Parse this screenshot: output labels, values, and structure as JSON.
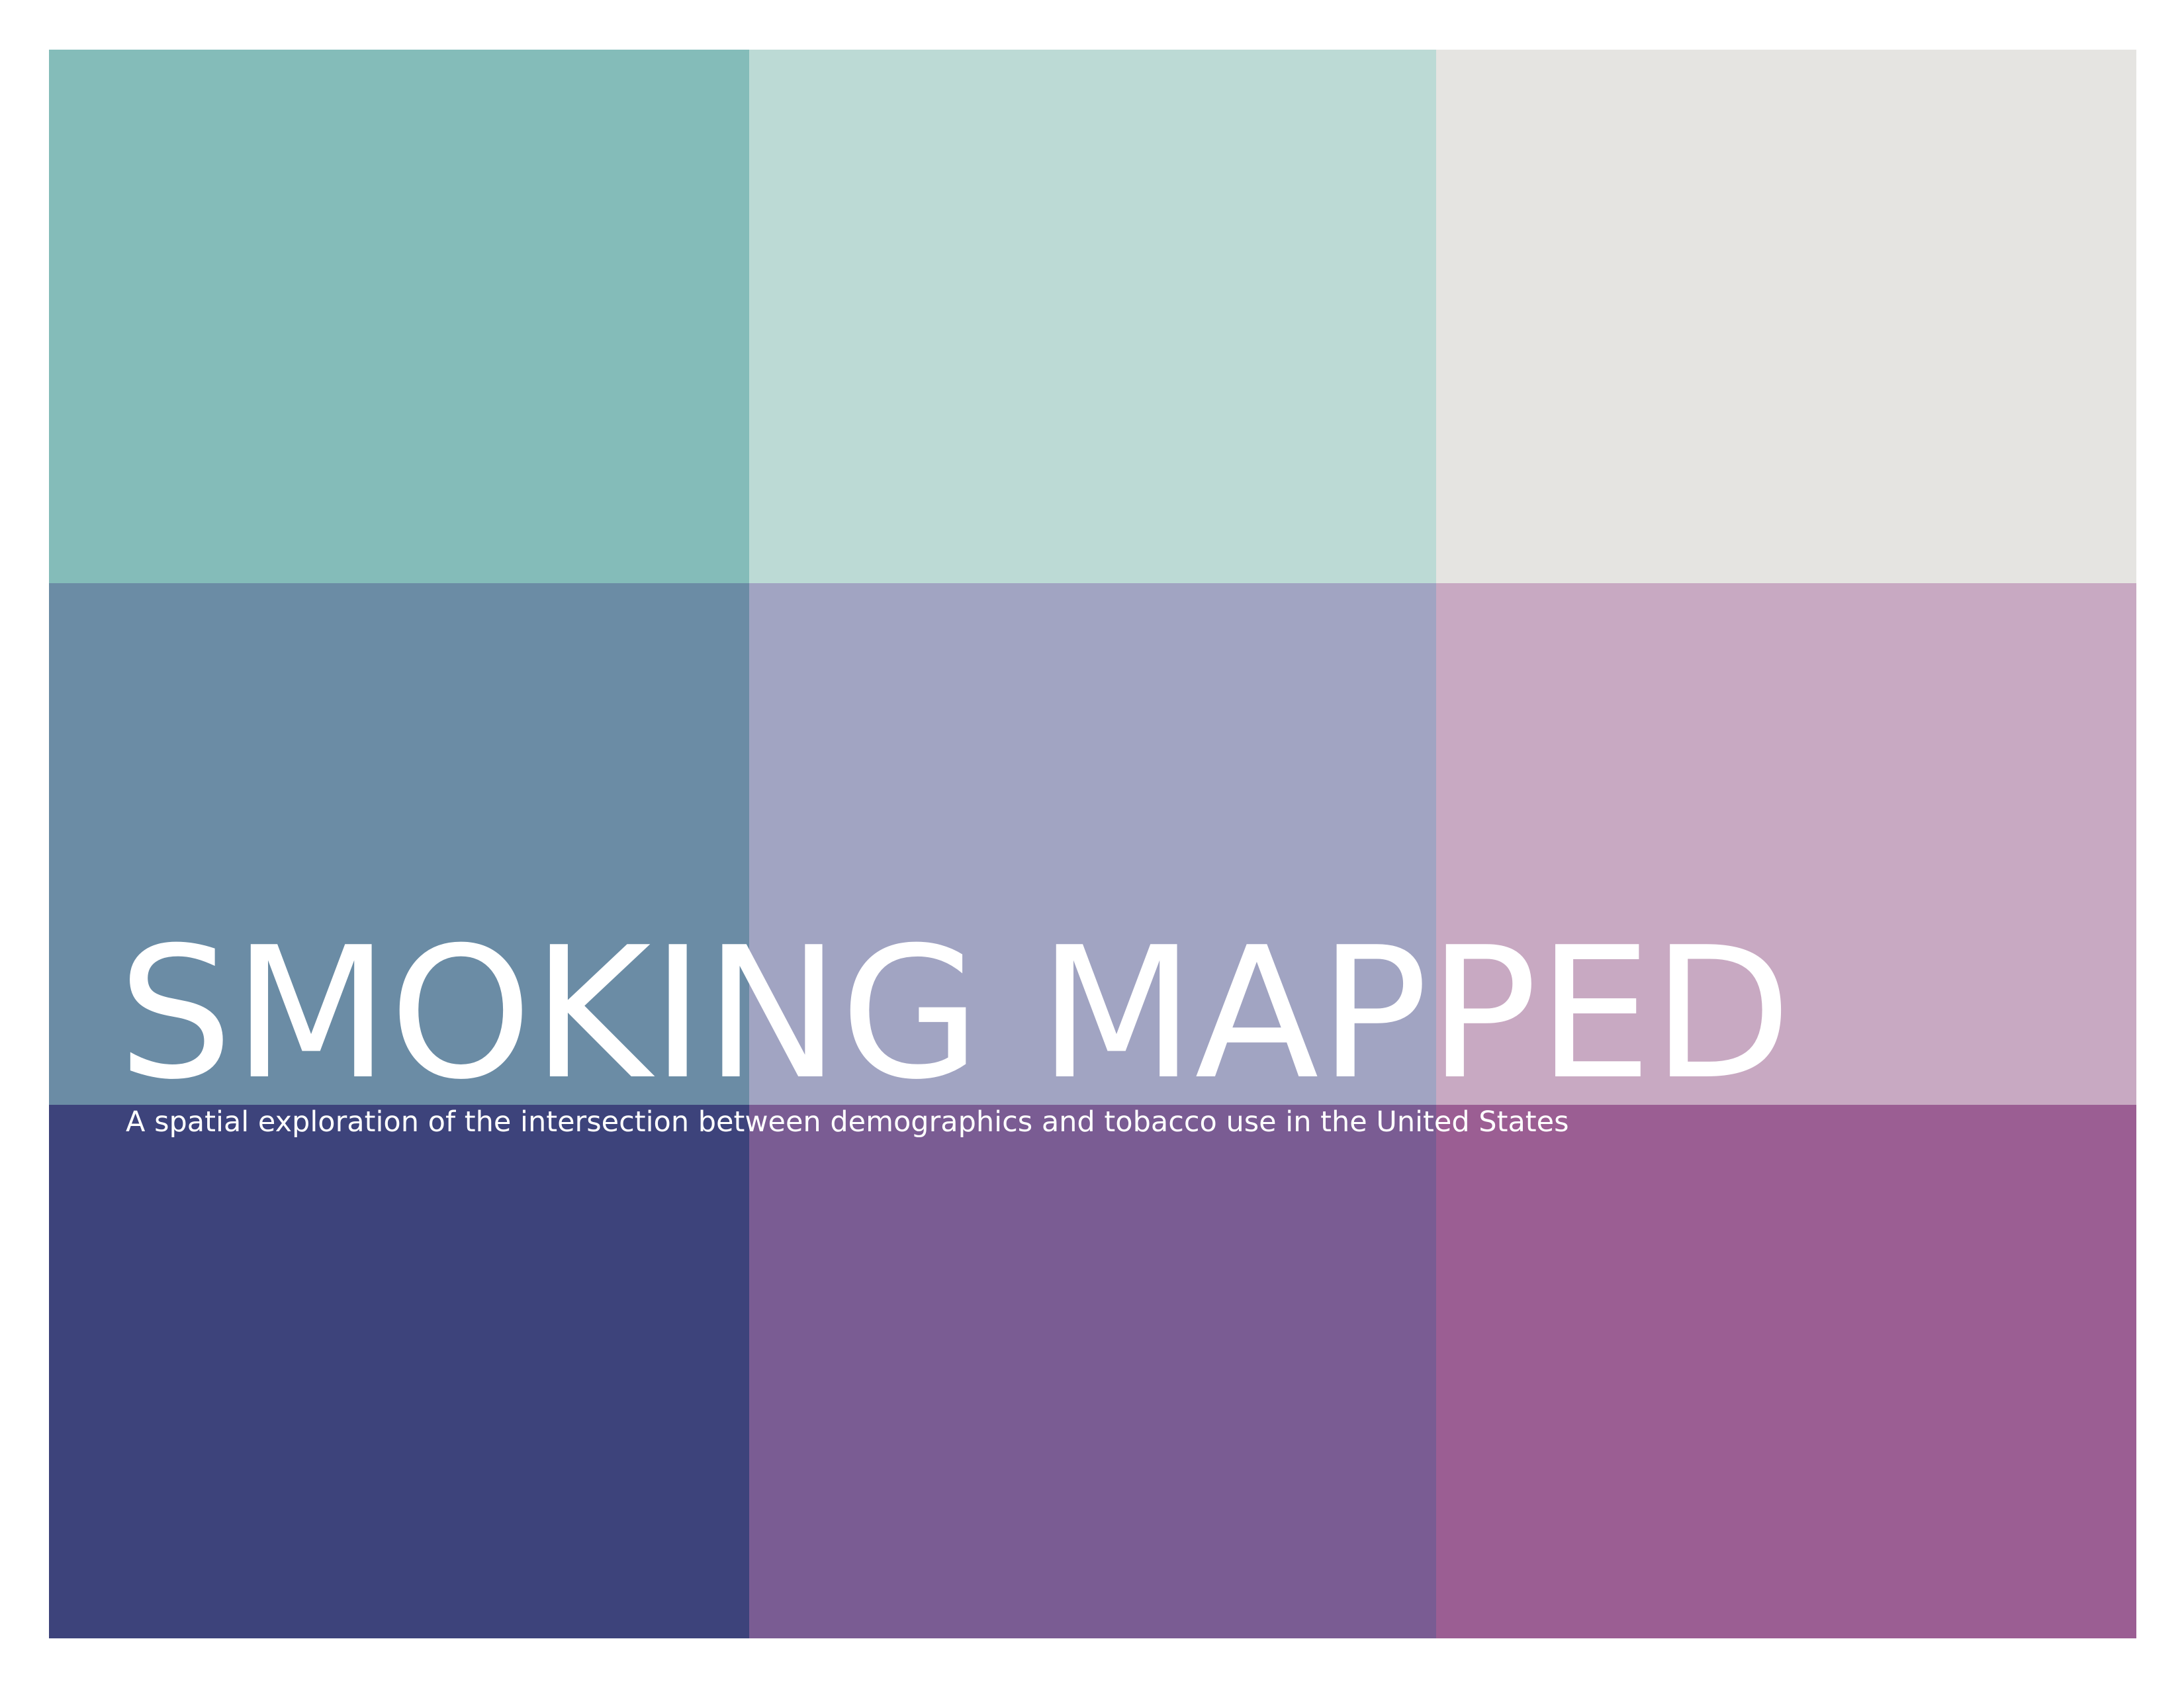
{
  "cover": {
    "title": "SMOKING MAPPED",
    "subtitle": "A spatial exploration of the intersection between demographics and tobacco use in the United States"
  },
  "swatches": [
    {
      "name": "swatch-row1-col1",
      "color": "#84BCB9"
    },
    {
      "name": "swatch-row1-col2",
      "color": "#BCDAD5"
    },
    {
      "name": "swatch-row1-col3",
      "color": "#E5E4E1"
    },
    {
      "name": "swatch-row2-col1",
      "color": "#6B8CA5"
    },
    {
      "name": "swatch-row2-col2",
      "color": "#A1A4C2"
    },
    {
      "name": "swatch-row2-col3",
      "color": "#C8A9C2"
    },
    {
      "name": "swatch-row3-col1",
      "color": "#3D437B"
    },
    {
      "name": "swatch-row3-col2",
      "color": "#7A5C93"
    },
    {
      "name": "swatch-row3-col3",
      "color": "#9B5E93"
    }
  ]
}
